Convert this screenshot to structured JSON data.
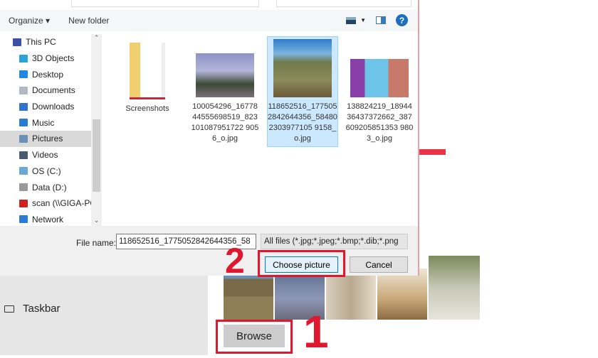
{
  "dialog": {
    "toolbar": {
      "organize": "Organize ▾",
      "new_folder": "New folder",
      "help": "?"
    },
    "nav": [
      {
        "label": "This PC",
        "icon": "computer-icon",
        "color": "#3a4fa8"
      },
      {
        "label": "3D Objects",
        "icon": "cube-icon",
        "color": "#29a3d8"
      },
      {
        "label": "Desktop",
        "icon": "desktop-icon",
        "color": "#1e88e5"
      },
      {
        "label": "Documents",
        "icon": "document-icon",
        "color": "#b0b8c4"
      },
      {
        "label": "Downloads",
        "icon": "download-icon",
        "color": "#2f74c9"
      },
      {
        "label": "Music",
        "icon": "music-icon",
        "color": "#2a7bd6"
      },
      {
        "label": "Pictures",
        "icon": "pictures-icon",
        "color": "#6c8fb5",
        "selected": true
      },
      {
        "label": "Videos",
        "icon": "video-icon",
        "color": "#4a5a70"
      },
      {
        "label": "OS (C:)",
        "icon": "drive-icon",
        "color": "#6aa8d8"
      },
      {
        "label": "Data (D:)",
        "icon": "drive-icon",
        "color": "#999999"
      },
      {
        "label": "scan (\\\\GIGA-PC)",
        "icon": "network-drive-icon",
        "color": "#d02020"
      },
      {
        "label": "Network",
        "icon": "network-icon",
        "color": "#2a7bd6"
      }
    ],
    "files": [
      {
        "name": "Screenshots",
        "type": "folder"
      },
      {
        "name": "100054296_1677844555698519_823101087951722 9056_o.jpg",
        "type": "image"
      },
      {
        "name": "118652516_1775052842644356_584802303977105 9158_o.jpg",
        "type": "image",
        "selected": true
      },
      {
        "name": "138824219_1894436437372662_387609205851353 9803_o.jpg",
        "type": "image"
      }
    ],
    "file_name_label": "File name:",
    "file_name_value": "118652516_1775052842644356_58",
    "filter": "All files (*.jpg;*.jpeg;*.bmp;*.dib;*.png",
    "choose": "Choose picture",
    "cancel": "Cancel"
  },
  "settings": {
    "taskbar": "Taskbar",
    "browse": "Browse"
  },
  "annotations": {
    "step1": "1",
    "step2": "2"
  },
  "accent": "#e0182f"
}
